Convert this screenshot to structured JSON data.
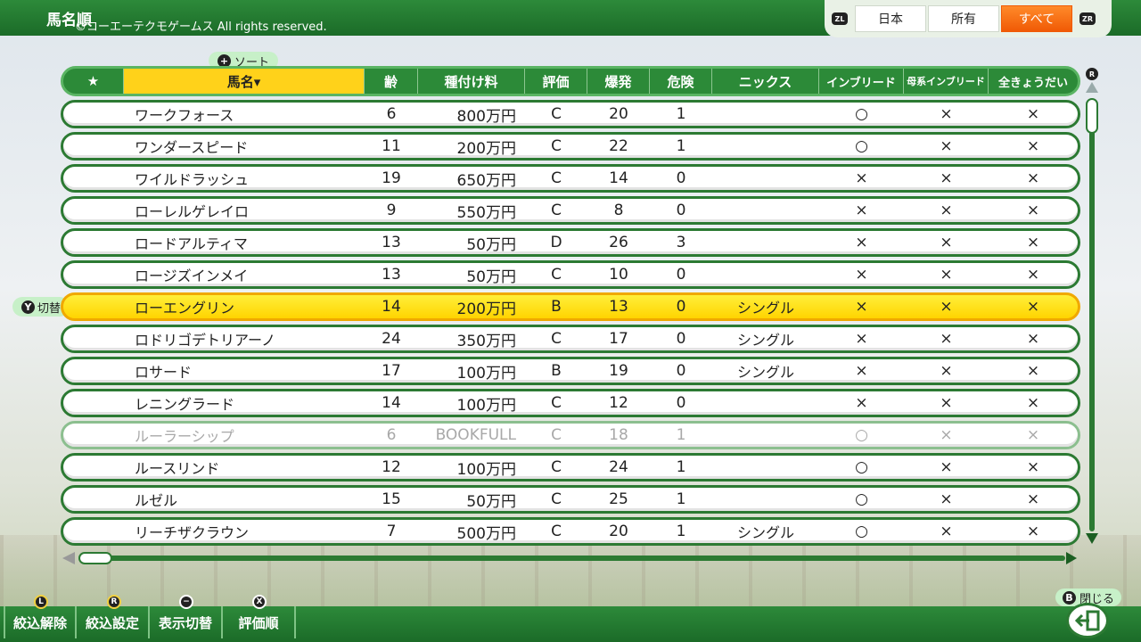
{
  "header": {
    "title": "馬名順",
    "copyright": "©コーエーテクモゲームス All rights reserved.",
    "zl": "ZL",
    "zr": "ZR",
    "filters": [
      {
        "label": "日本"
      },
      {
        "label": "所有"
      },
      {
        "label": "すべて"
      }
    ],
    "active_filter": "すべて"
  },
  "sort_tag": {
    "icon": "+",
    "label": "ソート"
  },
  "toggle_tag": {
    "icon": "Y",
    "label": "切替"
  },
  "table": {
    "columns": {
      "star": "★",
      "name": "馬名▾",
      "age": "齢",
      "fee": "種付け料",
      "grade": "評価",
      "burst": "爆発",
      "risk": "危険",
      "nicks": "ニックス",
      "inbreed": "インブリード",
      "mother_inbreed": "母系インブリード",
      "siblings": "全きょうだい"
    },
    "rows": [
      {
        "name": "ワークフォース",
        "age": "6",
        "fee": "800万円",
        "grade": "C",
        "burst": "20",
        "risk": "1",
        "nicks": "",
        "inbreed": "○",
        "mother": "×",
        "sib": "×"
      },
      {
        "name": "ワンダースピード",
        "age": "11",
        "fee": "200万円",
        "grade": "C",
        "burst": "22",
        "risk": "1",
        "nicks": "",
        "inbreed": "○",
        "mother": "×",
        "sib": "×"
      },
      {
        "name": "ワイルドラッシュ",
        "age": "19",
        "fee": "650万円",
        "grade": "C",
        "burst": "14",
        "risk": "0",
        "nicks": "",
        "inbreed": "×",
        "mother": "×",
        "sib": "×"
      },
      {
        "name": "ローレルゲレイロ",
        "age": "9",
        "fee": "550万円",
        "grade": "C",
        "burst": "8",
        "risk": "0",
        "nicks": "",
        "inbreed": "×",
        "mother": "×",
        "sib": "×"
      },
      {
        "name": "ロードアルティマ",
        "age": "13",
        "fee": "50万円",
        "grade": "D",
        "burst": "26",
        "risk": "3",
        "nicks": "",
        "inbreed": "×",
        "mother": "×",
        "sib": "×"
      },
      {
        "name": "ロージズインメイ",
        "age": "13",
        "fee": "50万円",
        "grade": "C",
        "burst": "10",
        "risk": "0",
        "nicks": "",
        "inbreed": "×",
        "mother": "×",
        "sib": "×"
      },
      {
        "name": "ローエングリン",
        "age": "14",
        "fee": "200万円",
        "grade": "B",
        "burst": "13",
        "risk": "0",
        "nicks": "シングル",
        "inbreed": "×",
        "mother": "×",
        "sib": "×"
      },
      {
        "name": "ロドリゴデトリアーノ",
        "age": "24",
        "fee": "350万円",
        "grade": "C",
        "burst": "17",
        "risk": "0",
        "nicks": "シングル",
        "inbreed": "×",
        "mother": "×",
        "sib": "×"
      },
      {
        "name": "ロサード",
        "age": "17",
        "fee": "100万円",
        "grade": "B",
        "burst": "19",
        "risk": "0",
        "nicks": "シングル",
        "inbreed": "×",
        "mother": "×",
        "sib": "×"
      },
      {
        "name": "レニングラード",
        "age": "14",
        "fee": "100万円",
        "grade": "C",
        "burst": "12",
        "risk": "0",
        "nicks": "",
        "inbreed": "×",
        "mother": "×",
        "sib": "×"
      },
      {
        "name": "ルーラーシップ",
        "age": "6",
        "fee": "BOOKFULL",
        "grade": "C",
        "burst": "18",
        "risk": "1",
        "nicks": "",
        "inbreed": "○",
        "mother": "×",
        "sib": "×"
      },
      {
        "name": "ルースリンド",
        "age": "12",
        "fee": "100万円",
        "grade": "C",
        "burst": "24",
        "risk": "1",
        "nicks": "",
        "inbreed": "○",
        "mother": "×",
        "sib": "×"
      },
      {
        "name": "ルゼル",
        "age": "15",
        "fee": "50万円",
        "grade": "C",
        "burst": "25",
        "risk": "1",
        "nicks": "",
        "inbreed": "○",
        "mother": "×",
        "sib": "×"
      },
      {
        "name": "リーチザクラウン",
        "age": "7",
        "fee": "500万円",
        "grade": "C",
        "burst": "20",
        "risk": "1",
        "nicks": "シングル",
        "inbreed": "○",
        "mother": "×",
        "sib": "×"
      }
    ],
    "selected_index": 6,
    "dimmed_index": 10
  },
  "scroll": {
    "r_label": "R"
  },
  "footer": {
    "buttons": [
      {
        "icon": "L",
        "label": "絞込解除"
      },
      {
        "icon": "R",
        "label": "絞込設定"
      },
      {
        "icon": "−",
        "label": "表示切替"
      },
      {
        "icon": "X",
        "label": "評価順"
      }
    ],
    "close_icon": "B",
    "close_label": "閉じる"
  }
}
